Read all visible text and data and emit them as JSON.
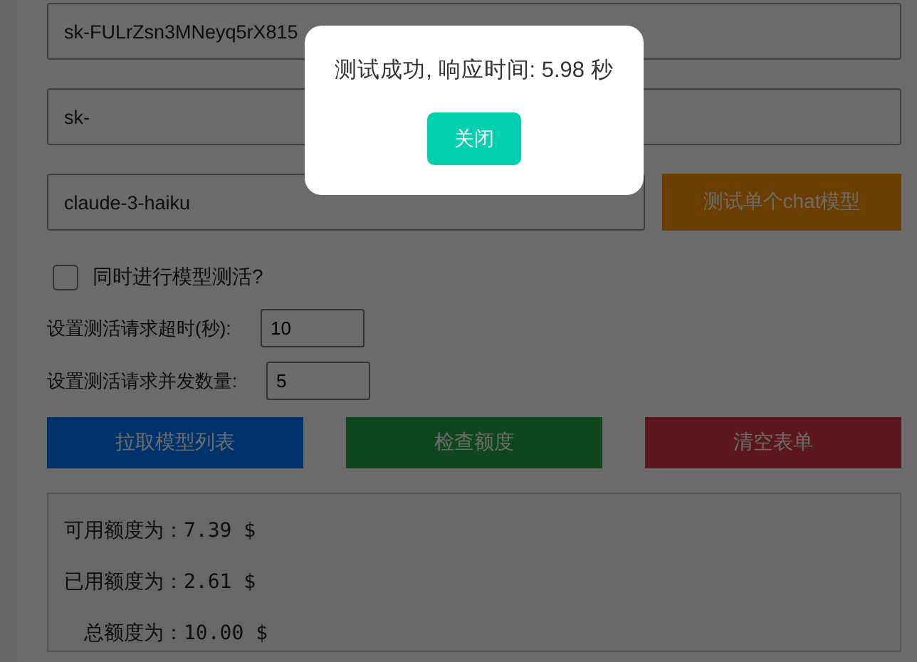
{
  "api_key_field": {
    "value": "sk-FULrZsn3MNeyq5rX815"
  },
  "api_url_field": {
    "value": "sk-"
  },
  "model_field": {
    "value": "claude-3-haiku"
  },
  "test_model_button": {
    "label": "测试单个chat模型"
  },
  "concurrent_test": {
    "label": "同时进行模型测活?",
    "checked": false
  },
  "timeout_setting": {
    "label": "设置测活请求超时(秒):",
    "value": "10"
  },
  "concurrency_setting": {
    "label": "设置测活请求并发数量:",
    "value": "5"
  },
  "action_buttons": [
    {
      "label": "拉取模型列表"
    },
    {
      "label": "检查额度"
    },
    {
      "label": "清空表单"
    }
  ],
  "quota_results": [
    {
      "label": "可用额度为：",
      "amount": "7.39 $"
    },
    {
      "label": "已用额度为：",
      "amount": "2.61 $"
    },
    {
      "label": "总额度为：",
      "amount": "10.00 $"
    }
  ],
  "dialog": {
    "message": "测试成功, 响应时间: 5.98 秒",
    "button": "关闭"
  }
}
